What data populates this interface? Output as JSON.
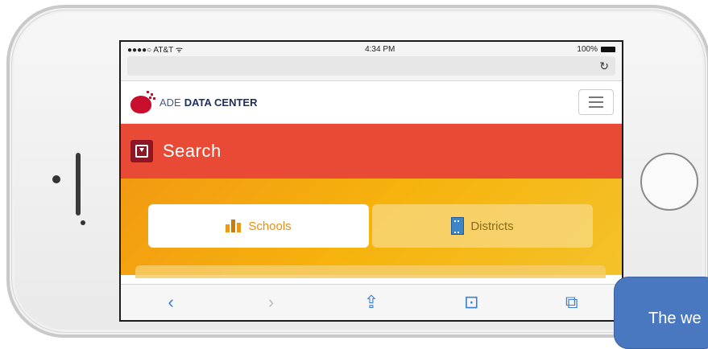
{
  "status_bar": {
    "carrier": "●●●●○ AT&T ",
    "wifi": "ᯤ",
    "time": "4:34 PM",
    "battery": "100%"
  },
  "browser": {
    "reload_icon": "reload-icon"
  },
  "site": {
    "logo_light": "ADE ",
    "logo_bold": "DATA CENTER"
  },
  "search": {
    "label": "Search"
  },
  "tabs": [
    {
      "label": "Schools",
      "icon": "school-building-icon",
      "active": true
    },
    {
      "label": "Districts",
      "icon": "district-building-icon",
      "active": false
    }
  ],
  "toolbar": {
    "back": "‹",
    "forward": "›",
    "share": "⇪",
    "bookmarks": "⊡",
    "tabs": "⧉"
  },
  "callout": {
    "text": "The we"
  },
  "colors": {
    "brand_red": "#e84a36",
    "dark_red": "#8e1524",
    "accent_orange": "#f29a12",
    "ios_blue": "#3a80d9"
  }
}
